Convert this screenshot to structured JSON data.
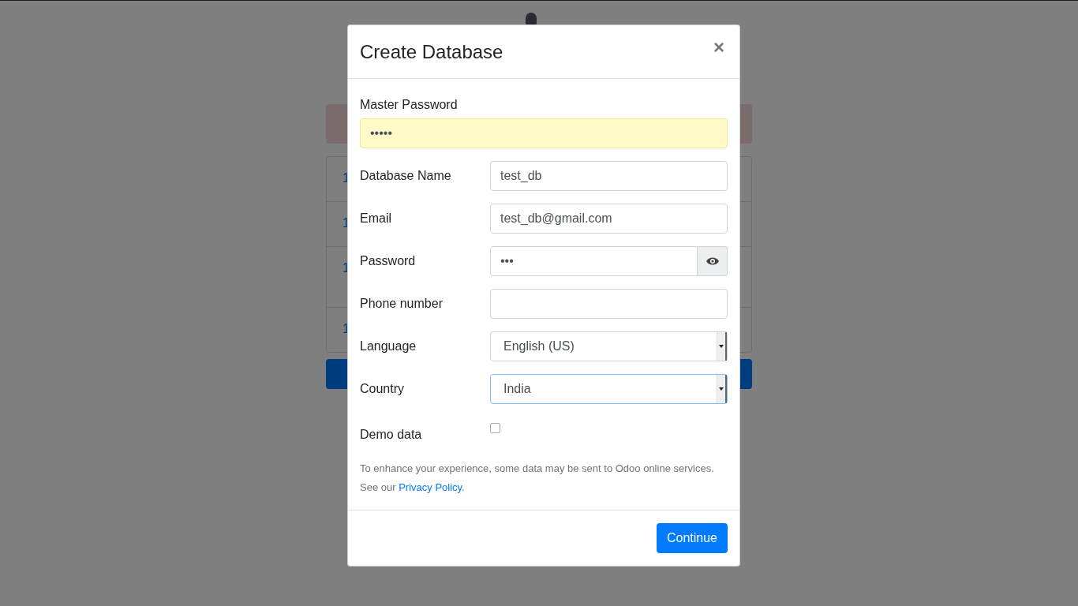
{
  "background": {
    "list_rows": [
      {
        "lines": [
          "1"
        ]
      },
      {
        "lines": [
          "1"
        ]
      },
      {
        "lines": [
          "1"
        ]
      },
      {
        "lines": [
          "1"
        ]
      }
    ]
  },
  "dialog": {
    "title": "Create Database",
    "close": "×",
    "master_password": {
      "label": "Master Password",
      "value": "•••••"
    },
    "fields": [
      {
        "kind": "text",
        "label": "Database Name",
        "value": "test_db"
      },
      {
        "kind": "text",
        "label": "Email",
        "value": "test_db@gmail.com"
      },
      {
        "kind": "password",
        "label": "Password",
        "value": "•••"
      },
      {
        "kind": "text",
        "label": "Phone number"
      },
      {
        "kind": "select",
        "label": "Language",
        "value": "English (US)",
        "focused": false
      },
      {
        "kind": "select",
        "label": "Country",
        "value": "India",
        "focused": true
      },
      {
        "kind": "checkbox",
        "label": "Demo data",
        "checked": false
      }
    ],
    "notice": "To enhance your experience, some data may be sent to Odoo online services.",
    "policy": {
      "prefix": "See our ",
      "link": "Privacy Policy",
      "suffix": "."
    },
    "submit": "Continue"
  }
}
